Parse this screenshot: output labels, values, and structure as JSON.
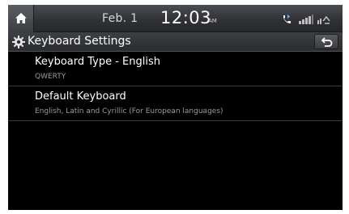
{
  "statusbar": {
    "date": "Feb.  1",
    "time": "12:03",
    "ampm": "AM",
    "icons": [
      "home-icon",
      "bluetooth-phone-icon",
      "signal-icon",
      "network-icon"
    ]
  },
  "titlebar": {
    "title": "Keyboard Settings",
    "icon": "gear-icon",
    "back_icon": "back-arrow-icon"
  },
  "settings": {
    "items": [
      {
        "label": "Keyboard Type - English",
        "value": "QWERTY"
      },
      {
        "label": "Default Keyboard",
        "value": "English, Latin and Cyrillic (For European languages)"
      }
    ]
  },
  "colors": {
    "background": "#000000",
    "text": "#ffffff",
    "subtext": "#9a9a9a",
    "bar": "#303236"
  }
}
